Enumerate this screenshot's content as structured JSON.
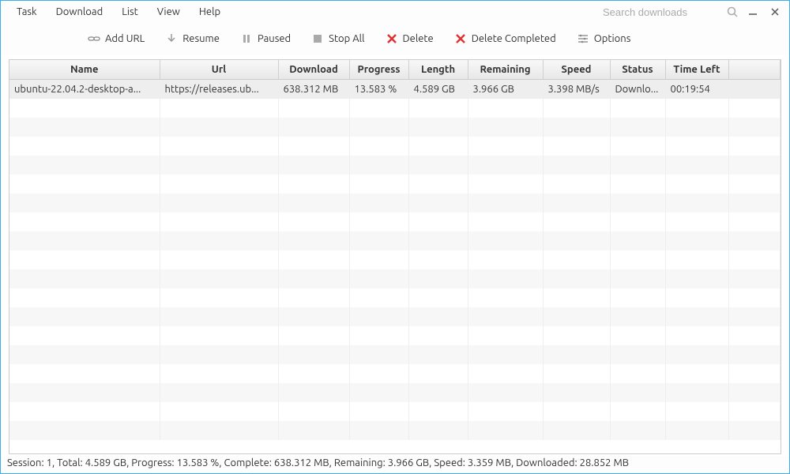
{
  "menu": {
    "task": "Task",
    "download": "Download",
    "list": "List",
    "view": "View",
    "help": "Help"
  },
  "search": {
    "placeholder": "Search downloads"
  },
  "toolbar": {
    "add_url": "Add URL",
    "resume": "Resume",
    "paused": "Paused",
    "stop_all": "Stop All",
    "delete": "Delete",
    "delete_completed": "Delete Completed",
    "options": "Options"
  },
  "columns": {
    "name": "Name",
    "url": "Url",
    "download": "Download",
    "progress": "Progress",
    "length": "Length",
    "remaining": "Remaining",
    "speed": "Speed",
    "status": "Status",
    "time_left": "Time Left"
  },
  "rows": [
    {
      "name": "ubuntu-22.04.2-desktop-a...",
      "url": "https://releases.ub...",
      "download": "638.312 MB",
      "progress": "13.583 %",
      "length": "4.589 GB",
      "remaining": "3.966 GB",
      "speed": "3.398 MB/s",
      "status": "Downlo...",
      "time_left": "00:19:54"
    }
  ],
  "statusbar": "Session: 1, Total: 4.589 GB, Progress: 13.583 %, Complete: 638.312 MB, Remaining: 3.966 GB, Speed: 3.359 MB, Downloaded: 28.852 MB"
}
